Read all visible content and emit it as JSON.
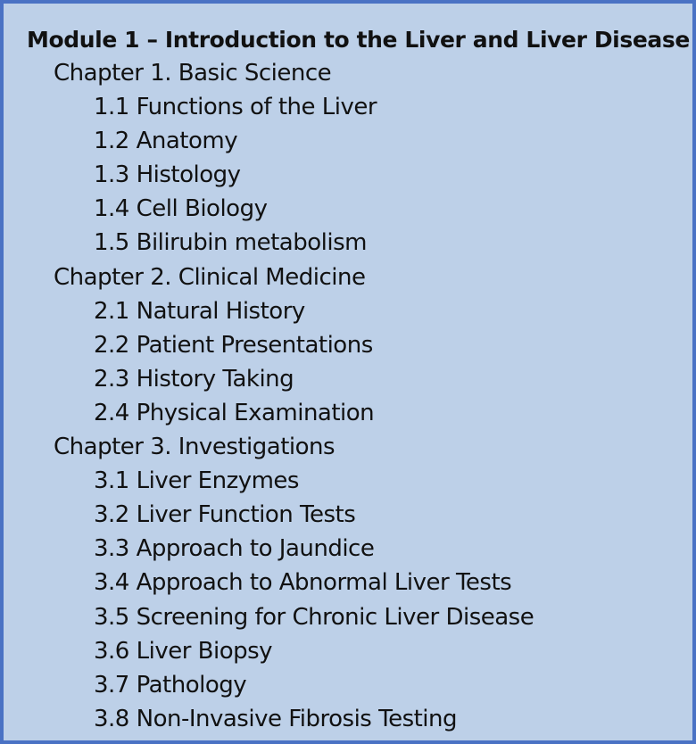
{
  "module": {
    "title": "Module 1 – Introduction to the Liver and Liver Disease",
    "chapters": [
      {
        "title": "Chapter 1. Basic Science",
        "sections": [
          "1.1 Functions of the Liver",
          "1.2 Anatomy",
          "1.3 Histology",
          "1.4 Cell Biology",
          "1.5 Bilirubin metabolism"
        ]
      },
      {
        "title": "Chapter 2. Clinical Medicine",
        "sections": [
          "2.1 Natural History",
          "2.2 Patient Presentations",
          "2.3 History Taking",
          "2.4 Physical Examination"
        ]
      },
      {
        "title": "Chapter 3. Investigations",
        "sections": [
          "3.1 Liver Enzymes",
          "3.2 Liver Function Tests",
          "3.3 Approach to Jaundice",
          "3.4 Approach to Abnormal Liver Tests",
          "3.5 Screening for Chronic Liver Disease",
          "3.6 Liver Biopsy",
          "3.7 Pathology",
          "3.8 Non-Invasive Fibrosis Testing"
        ]
      }
    ]
  },
  "colors": {
    "box_background": "#bdd0e8",
    "box_border": "#4a72c4",
    "text": "#111111"
  }
}
